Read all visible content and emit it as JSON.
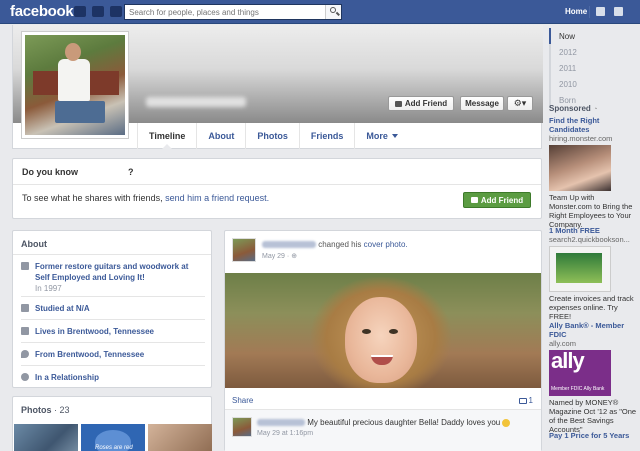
{
  "topbar": {
    "logo": "facebook",
    "search_placeholder": "Search for people, places and things",
    "home": "Home"
  },
  "profile": {
    "buttons": {
      "add_friend": "Add Friend",
      "message": "Message"
    },
    "tabs": [
      "Timeline",
      "About",
      "Photos",
      "Friends",
      "More"
    ]
  },
  "timeline_nav": [
    "Now",
    "2012",
    "2011",
    "2010",
    "Born"
  ],
  "know_box": {
    "title": "Do you know",
    "title_end": "?",
    "text": "To see what he shares with friends, ",
    "link": "send him a friend request.",
    "button": "Add Friend"
  },
  "about": {
    "title": "About",
    "items": [
      {
        "icon": "briefcase-icon",
        "text": "Former restore guitars and woodwork at Self Employed and Loving It!",
        "sub": "In 1997"
      },
      {
        "icon": "school-icon",
        "text": "Studied at N/A"
      },
      {
        "icon": "home-icon",
        "text": "Lives in Brentwood, Tennessee"
      },
      {
        "icon": "location-icon",
        "text": "From Brentwood, Tennessee"
      },
      {
        "icon": "heart-icon",
        "text": "In a Relationship"
      }
    ]
  },
  "photos": {
    "title": "Photos",
    "count": "· 23",
    "thumb2_caption": "Roses are red"
  },
  "post": {
    "action": "changed his",
    "link": "cover photo.",
    "date": "May 29",
    "share": "Share",
    "comment_count": "1",
    "comment": {
      "text": "My beautiful precious daughter Bella! Daddy loves you",
      "date": "May 29 at 1:16pm"
    }
  },
  "sponsored": {
    "title": "Sponsored",
    "ads": [
      {
        "title": "Find the Right Candidates",
        "url": "hiring.monster.com",
        "body": "Team Up with Monster.com to Bring the Right Employees to Your Company."
      },
      {
        "title": "1 Month FREE",
        "url": "search2.quickbookson...",
        "body": "Create invoices and track expenses online. Try FREE!"
      },
      {
        "title": "Ally Bank® - Member FDIC",
        "url": "ally.com",
        "body": "Named by MONEY® Magazine Oct '12 as \"One of the Best Savings Accounts\""
      },
      {
        "title": "Pay 1 Price for 5 Years"
      }
    ],
    "ally_logo": "ally",
    "ally_fdic": "Member FDIC   Ally Bank"
  },
  "colors": {
    "brand": "#3b5998",
    "green": "#5b9c42",
    "background": "#e9eaed"
  }
}
